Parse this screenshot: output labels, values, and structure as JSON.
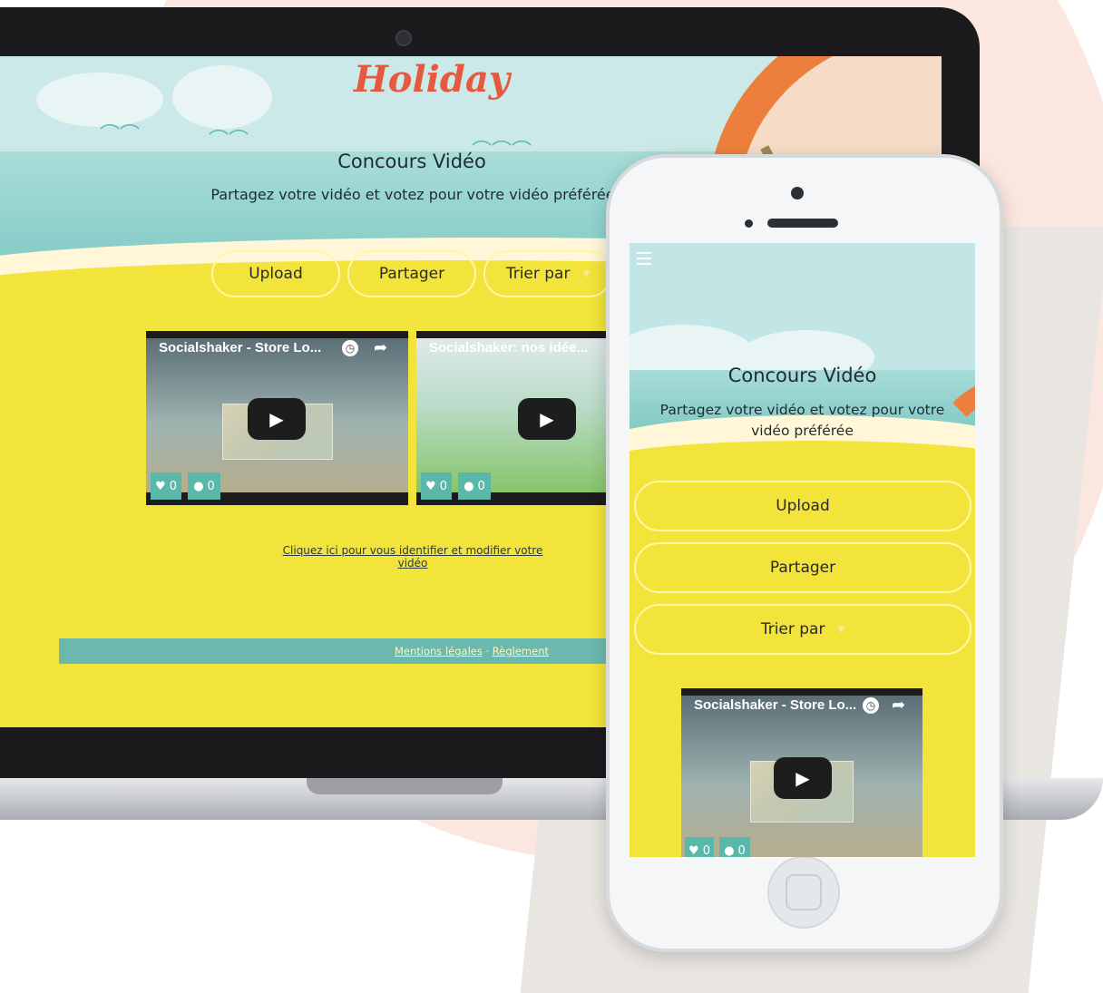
{
  "brand": {
    "logo_text": "Holiday",
    "accent": "#e55a3f",
    "button_border": "#fff6a6",
    "footer_bg": "#6ab8ae",
    "badge_bg": "#5ab8aa"
  },
  "desktop": {
    "title": "Concours Vidéo",
    "subtitle": "Partagez votre vidéo et votez pour votre vidéo préférée",
    "buttons": {
      "upload": "Upload",
      "share": "Partager",
      "sort": "Trier par"
    },
    "videos": [
      {
        "title": "Socialshaker - Store Lo...",
        "likes": "0",
        "comments": "0"
      },
      {
        "title": "Socialshaker: nos idée...",
        "likes": "0",
        "comments": "0"
      }
    ],
    "login_link": "Cliquez ici pour vous identifier et modifier votre vidéo",
    "footer": {
      "legal": "Mentions légales",
      "separator": " · ",
      "rules": "Règlement"
    }
  },
  "mobile": {
    "title": "Concours Vidéo",
    "subtitle": "Partagez votre vidéo et votez pour votre vidéo préférée",
    "buttons": {
      "upload": "Upload",
      "share": "Partager",
      "sort": "Trier par"
    },
    "video": {
      "title": "Socialshaker - Store Lo...",
      "likes": "0",
      "comments": "0"
    }
  },
  "icons": {
    "play": "▶",
    "heart": "♥",
    "comment": "●",
    "caret": "▼",
    "share": "➦",
    "clock": "◷"
  }
}
